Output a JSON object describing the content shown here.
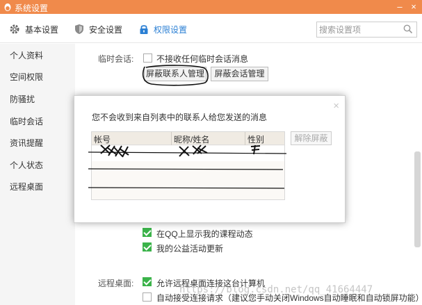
{
  "window": {
    "title": "系统设置",
    "minimize_glyph": "–",
    "close_glyph": "×"
  },
  "toolbar": {
    "tabs": [
      {
        "label": "基本设置",
        "icon": "gear-icon"
      },
      {
        "label": "安全设置",
        "icon": "shield-icon"
      },
      {
        "label": "权限设置",
        "icon": "lock-icon"
      }
    ],
    "active_tab": "权限设置",
    "search_placeholder": "搜索设置项"
  },
  "sidebar": {
    "items": [
      "个人资料",
      "空间权限",
      "防骚扰",
      "临时会话",
      "资讯提醒",
      "个人状态",
      "远程桌面"
    ]
  },
  "temp_chat": {
    "label": "临时会话:",
    "option": "不接收任何临时会话消息",
    "option_checked": false,
    "block_contacts_button": "屏蔽联系人管理",
    "block_sessions_button": "屏蔽会话管理"
  },
  "privacy": {
    "options": [
      {
        "label": "在QQ上显示我的课程动态",
        "checked": true
      },
      {
        "label": "我的公益活动更新",
        "checked": true
      }
    ]
  },
  "remote_desktop": {
    "label": "远程桌面:",
    "options": [
      {
        "label": "允许远程桌面连接这台计算机",
        "checked": true
      },
      {
        "label": "自动接受连接请求（建议您手动关闭Windows自动睡眠和自动锁屏功能）",
        "checked": false
      }
    ]
  },
  "dialog": {
    "close_glyph": "×",
    "message": "您不会收到来自列表中的联系人给您发送的消息",
    "columns": [
      "帐号",
      "昵称/姓名",
      "性别"
    ],
    "unblock_button": "解除屏蔽"
  },
  "watermark": "https://blog.csdn.net/qq_41664447",
  "colors": {
    "title_bar": "#f08a4b",
    "active_tab": "#2a7fd4",
    "checkbox_checked": "#3bb34a"
  }
}
